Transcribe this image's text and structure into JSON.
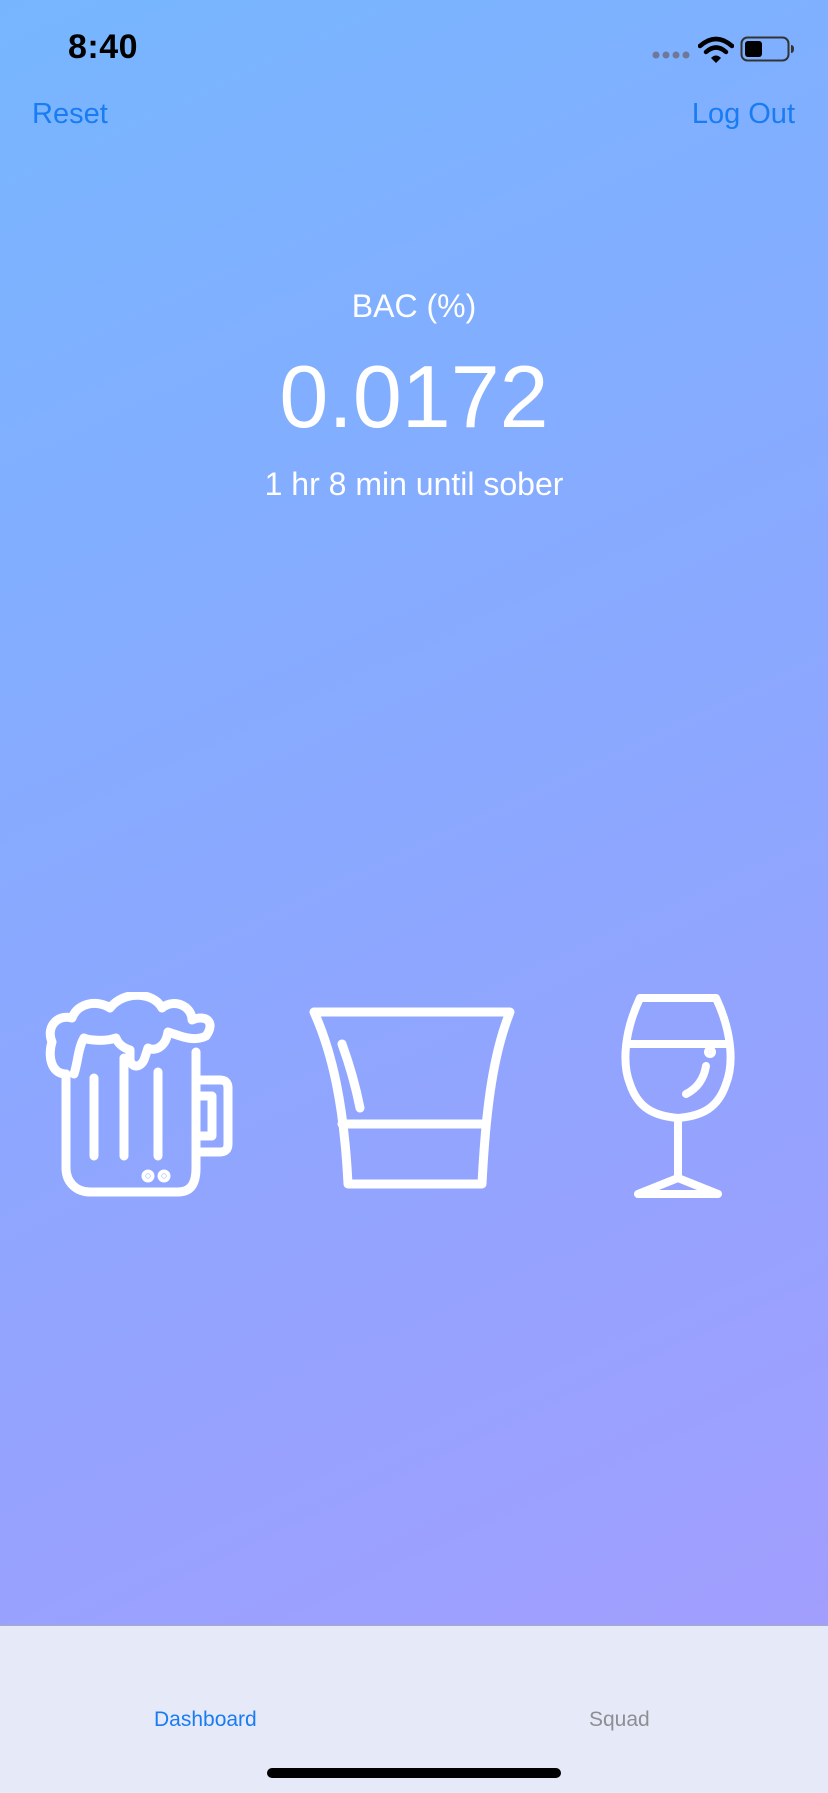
{
  "status_bar": {
    "time": "8:40"
  },
  "nav": {
    "reset_label": "Reset",
    "logout_label": "Log Out"
  },
  "bac": {
    "label": "BAC (%)",
    "value": "0.0172",
    "sober_text": "1 hr 8 min until sober"
  },
  "drinks": [
    {
      "name": "beer",
      "icon": "beer-mug-icon"
    },
    {
      "name": "shot",
      "icon": "shot-glass-icon"
    },
    {
      "name": "wine",
      "icon": "wine-glass-icon"
    }
  ],
  "tab_bar": {
    "tabs": [
      {
        "label": "Dashboard",
        "selected": true
      },
      {
        "label": "Squad",
        "selected": false
      }
    ]
  },
  "colors": {
    "accent": "#1a7cf2",
    "gradient_start": "#77b6ff",
    "gradient_end": "#a59cfd",
    "tab_inactive": "#8e8e93"
  }
}
